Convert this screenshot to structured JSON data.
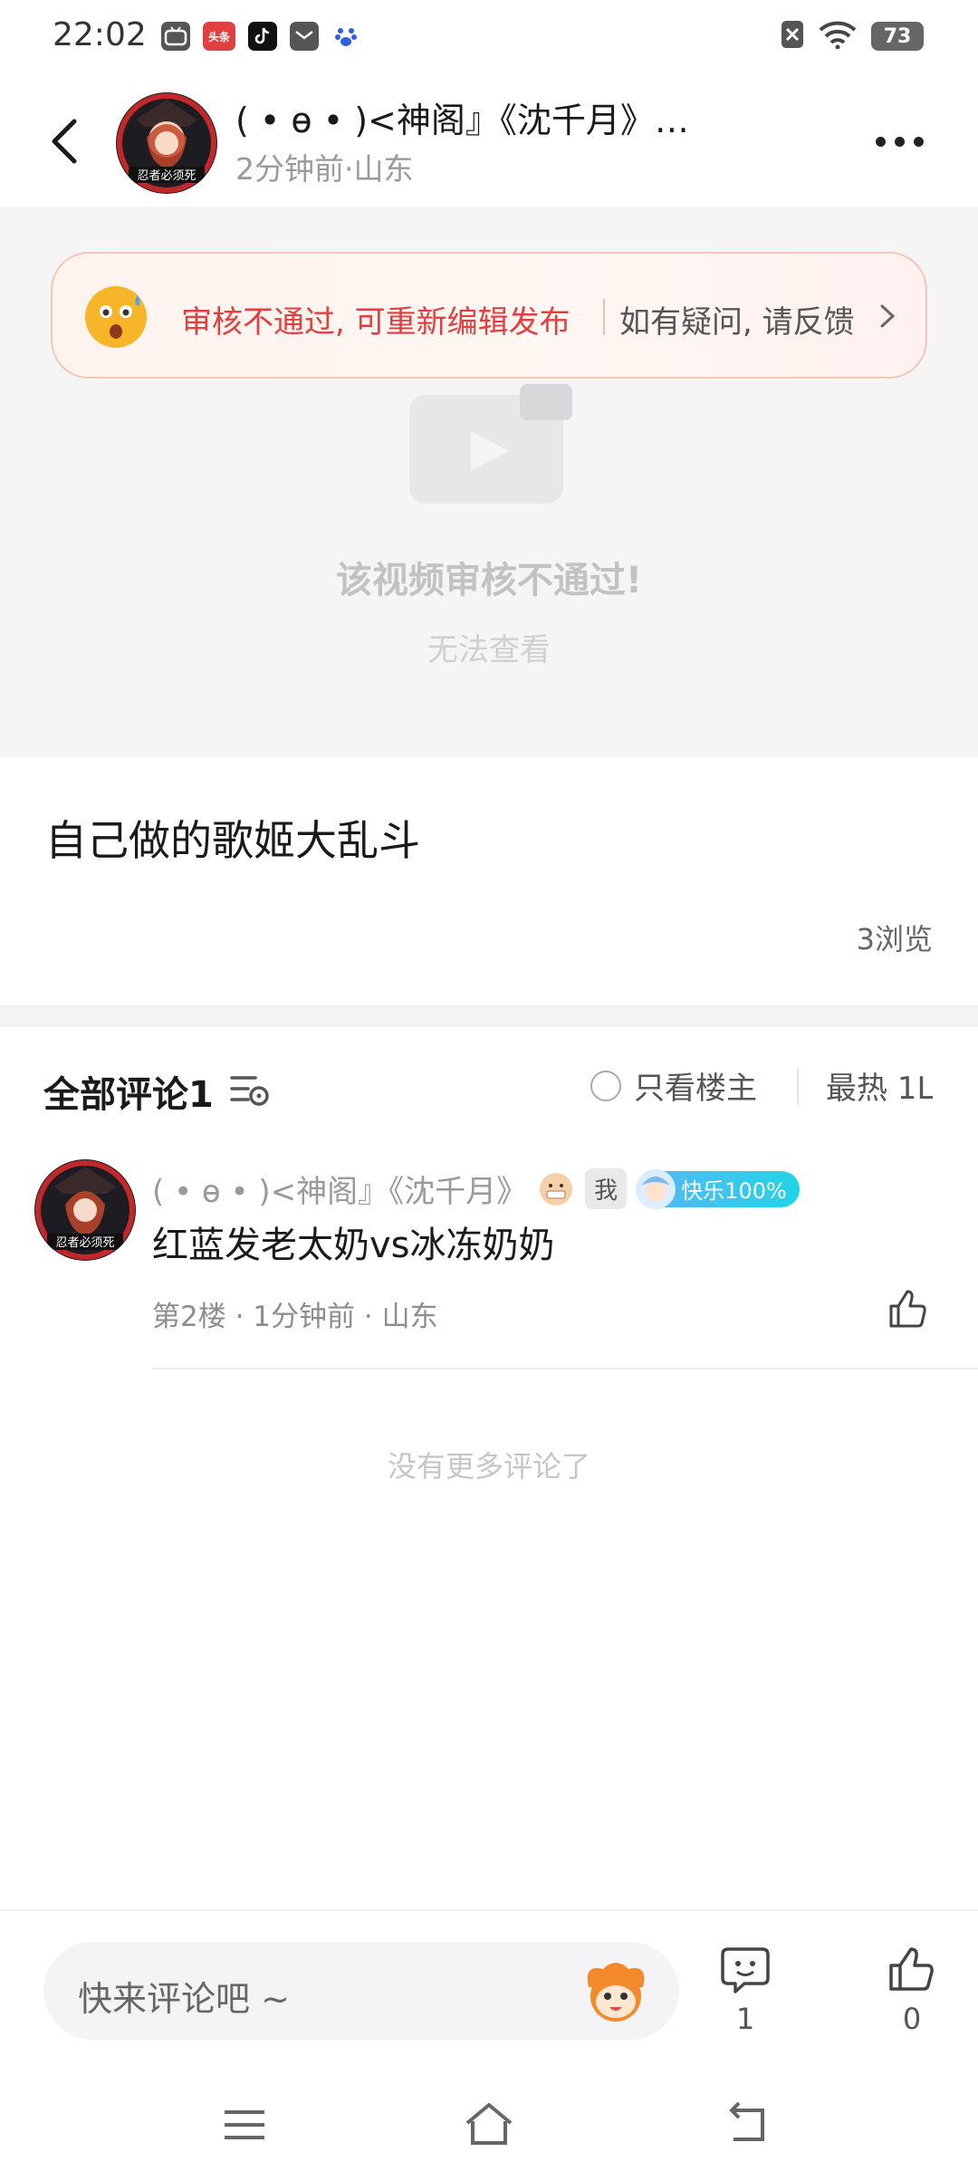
{
  "status_bar": {
    "time": "22:02",
    "left_icons": [
      "bilibili-tv-icon",
      "toutiao-icon",
      "tiktok-icon",
      "mail-box-icon",
      "baidu-icon"
    ],
    "toutiao_text": "头条",
    "battery": "73"
  },
  "header": {
    "title": "( • ɵ • )<神阁』《沈千月》…",
    "subtitle": "2分钟前·山东",
    "avatar_icon": "user-avatar"
  },
  "video": {
    "banner_main": "审核不通过, 可重新编辑发布",
    "banner_side": "如有疑问, 请反馈",
    "fail_text": "该视频审核不通过!",
    "fail_sub": "无法查看"
  },
  "post": {
    "title": "自己做的歌姬大乱斗",
    "views": "3浏览"
  },
  "comments_header": {
    "title": "全部评论1",
    "only_owner": "只看楼主",
    "sort": "最热 1L"
  },
  "comment": {
    "author": "( • ɵ • )<神阁』《沈千月》",
    "badge_me": "我",
    "badge_happy": "快乐100%",
    "text": "红蓝发老太奶vs冰冻奶奶",
    "info": "第2楼 · 1分钟前 · 山东"
  },
  "no_more": "没有更多评论了",
  "bottom_bar": {
    "input_placeholder": "快来评论吧 ~",
    "comment_count": "1",
    "like_count": "0"
  },
  "colors": {
    "banner_red": "#e0403f",
    "happy_badge": "#22d3e5"
  }
}
